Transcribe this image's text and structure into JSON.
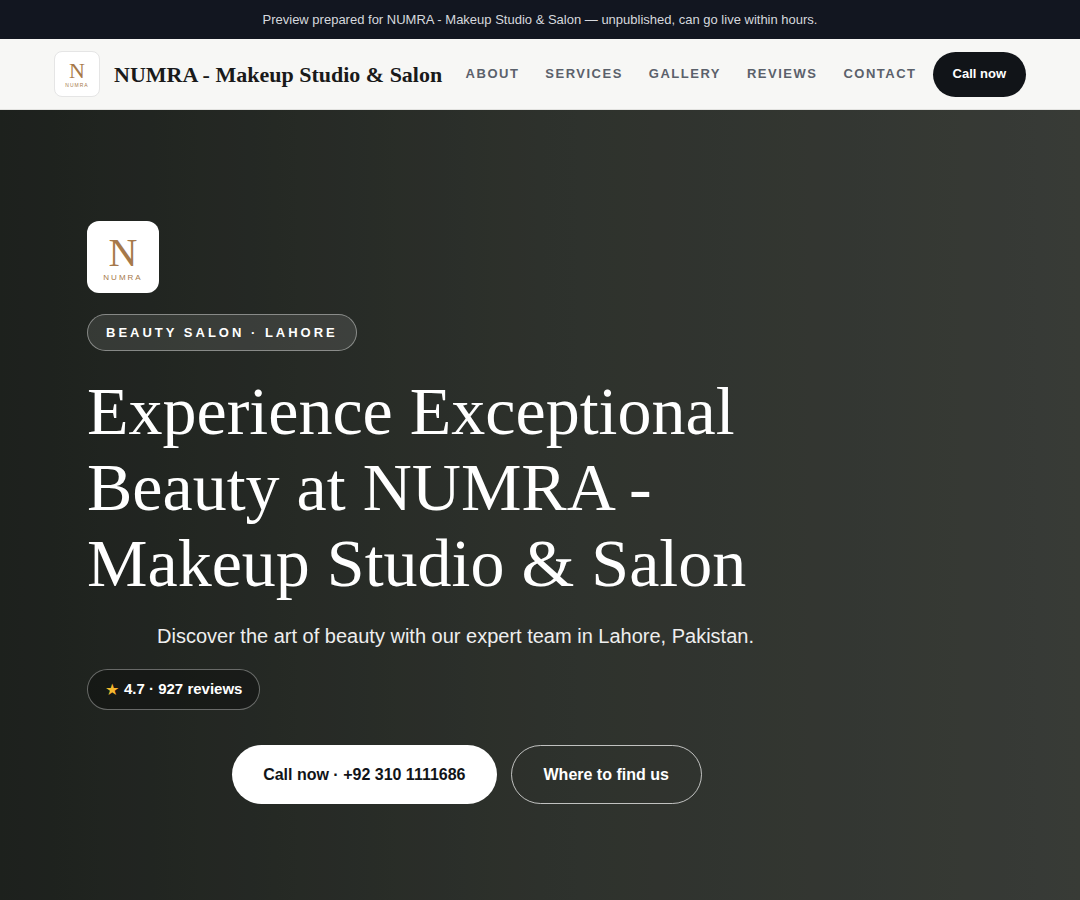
{
  "banner": {
    "text": "Preview prepared for NUMRA - Makeup Studio & Salon — unpublished, can go live within hours."
  },
  "logo": {
    "mark": "N",
    "wordmark": "NUMRA"
  },
  "nav": {
    "brand": "NUMRA - Makeup Studio & Salon",
    "links": [
      "ABOUT",
      "SERVICES",
      "GALLERY",
      "REVIEWS",
      "CONTACT"
    ],
    "cta": "Call now"
  },
  "hero": {
    "badge": "BEAUTY SALON · LAHORE",
    "title": "Experience Exceptional Beauty at NUMRA - Makeup Studio & Salon",
    "subtitle": "Discover the art of beauty with our expert team in Lahore, Pakistan.",
    "rating": {
      "star": "★",
      "text": "4.7 · 927 reviews"
    },
    "buttons": [
      {
        "label": "Call now · +92 310 1111686",
        "kind": "primary"
      },
      {
        "label": "Where to find us",
        "kind": "secondary"
      }
    ]
  }
}
